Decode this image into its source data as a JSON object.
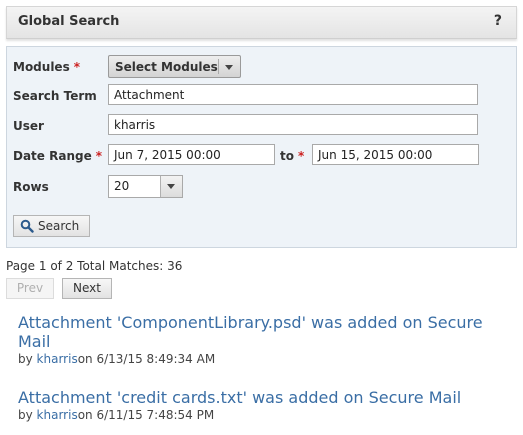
{
  "header": {
    "title": "Global Search",
    "help": "?"
  },
  "form": {
    "modules": {
      "label": "Modules",
      "required": "*",
      "button_label": "Select Modules"
    },
    "search_term": {
      "label": "Search Term",
      "value": "Attachment"
    },
    "user": {
      "label": "User",
      "value": "kharris"
    },
    "date_range": {
      "label": "Date Range",
      "required": "*",
      "from": "Jun 7, 2015 00:00",
      "to_label": "to",
      "to": "Jun 15, 2015 00:00"
    },
    "rows": {
      "label": "Rows",
      "value": "20"
    },
    "search_button": "Search"
  },
  "pagination": {
    "page_info": "Page 1 of 2",
    "total_matches": "Total Matches: 36",
    "prev": "Prev",
    "next": "Next"
  },
  "results": [
    {
      "title_line1": "Attachment 'ComponentLibrary.psd' was added on Secure",
      "title_line2": "Mail",
      "by": "by",
      "user": "kharris",
      "date": "on 6/13/15 8:49:34 AM"
    },
    {
      "title_line1": "Attachment 'credit cards.txt' was added on Secure Mail",
      "by": "by",
      "user": "kharris",
      "date": "on 6/11/15 7:48:54 PM"
    }
  ],
  "colors": {
    "link": "#3a6ea5",
    "required": "#cc2222",
    "form_bg": "#eef3f8"
  }
}
